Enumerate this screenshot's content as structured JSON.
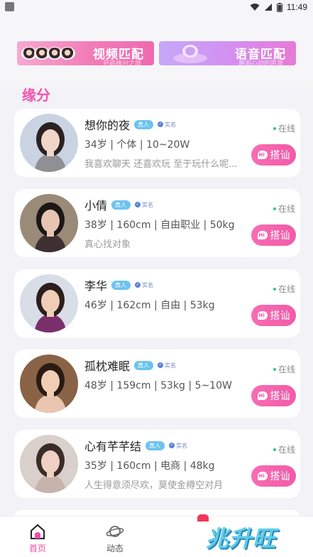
{
  "status_bar": {
    "time": "11:49"
  },
  "banners": [
    {
      "title": "视频匹配",
      "subtitle": "开启缘分之旅"
    },
    {
      "title": "语音匹配",
      "subtitle": "邂逅心动的声音"
    }
  ],
  "section_title": "缘分",
  "tags": {
    "real": "真人",
    "verified": "实名"
  },
  "cards": [
    {
      "name": "想你的夜",
      "meta": "34岁 | 个体 | 10~20W",
      "bio": "我喜欢聊天 还喜欢玩 至于玩什么呢...",
      "status": "在线",
      "button": "搭讪",
      "avatar_bg": "#c9d3e2",
      "hair": "#2a2120",
      "skin": "#efd6c9",
      "cloth": "#8f8f96"
    },
    {
      "name": "小倩",
      "meta": "38岁 | 160cm | 自由职业 | 50kg",
      "bio": "真心找对象",
      "status": "在线",
      "button": "搭讪",
      "avatar_bg": "#9a8a78",
      "hair": "#1c1716",
      "skin": "#e8c5b3",
      "cloth": "#3e2f30"
    },
    {
      "name": "李华",
      "meta": "46岁 | 162cm | 自由 | 53kg",
      "bio": "",
      "status": "在线",
      "button": "搭讪",
      "avatar_bg": "#d8dde8",
      "hair": "#2b1e1d",
      "skin": "#f0cdb6",
      "cloth": "#7a2f6a"
    },
    {
      "name": "孤枕难眠",
      "meta": "48岁 | 159cm | 53kg | 5~10W",
      "bio": "",
      "status": "在线",
      "button": "搭讪",
      "avatar_bg": "#8a6245",
      "hair": "#2a1a14",
      "skin": "#f2cdb5",
      "cloth": "#e9c6b0"
    },
    {
      "name": "心有芊芊结",
      "meta": "35岁 | 160cm | 电商 | 48kg",
      "bio": "人生得意须尽欢，莫使金樽空对月",
      "status": "在线",
      "button": "搭讪",
      "avatar_bg": "#d9cfcb",
      "hair": "#3a2c28",
      "skin": "#efd0c2",
      "cloth": "#c8b3ac"
    }
  ],
  "nav": {
    "home": "首页",
    "moments": "动态"
  },
  "watermark": "兆升旺",
  "colors": {
    "accent": "#f056ad",
    "online": "#2ecc71"
  }
}
